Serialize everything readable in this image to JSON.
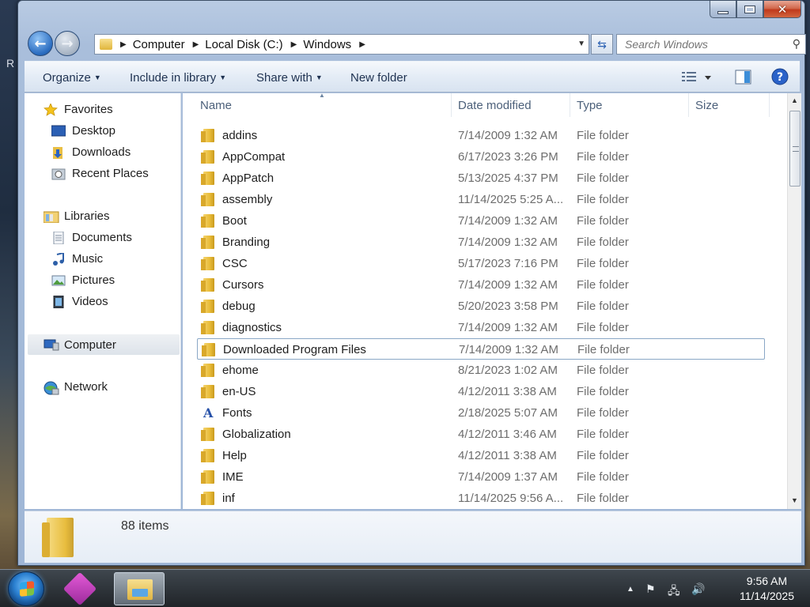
{
  "desktop": {
    "ghost_text": "R"
  },
  "window": {
    "caption": {
      "minimize": "—",
      "maximize": "▢",
      "close": "✕"
    }
  },
  "nav": {
    "back_glyph": "←",
    "forward_glyph": "→",
    "breadcrumbs": [
      "Computer",
      "Local Disk (C:)",
      "Windows"
    ],
    "crumb_separator": "▶",
    "search_placeholder": "Search Windows"
  },
  "toolbar": {
    "organize": "Organize",
    "include_in_library": "Include in library",
    "share_with": "Share with",
    "new_folder": "New folder"
  },
  "sidebar": {
    "favorites": {
      "label": "Favorites",
      "items": [
        "Desktop",
        "Downloads",
        "Recent Places"
      ]
    },
    "libraries": {
      "label": "Libraries",
      "items": [
        "Documents",
        "Music",
        "Pictures",
        "Videos"
      ]
    },
    "computer": "Computer",
    "network": "Network"
  },
  "columns": {
    "name": "Name",
    "date": "Date modified",
    "type": "Type",
    "size": "Size"
  },
  "files": [
    {
      "name": "addins",
      "date": "7/14/2009 1:32 AM",
      "type": "File folder",
      "icon": "folder-icon"
    },
    {
      "name": "AppCompat",
      "date": "6/17/2023 3:26 PM",
      "type": "File folder",
      "icon": "folder-icon"
    },
    {
      "name": "AppPatch",
      "date": "5/13/2025 4:37 PM",
      "type": "File folder",
      "icon": "folder-icon"
    },
    {
      "name": "assembly",
      "date": "11/14/2025 5:25 A...",
      "type": "File folder",
      "icon": "folder-icon"
    },
    {
      "name": "Boot",
      "date": "7/14/2009 1:32 AM",
      "type": "File folder",
      "icon": "folder-icon"
    },
    {
      "name": "Branding",
      "date": "7/14/2009 1:32 AM",
      "type": "File folder",
      "icon": "folder-icon"
    },
    {
      "name": "CSC",
      "date": "5/17/2023 7:16 PM",
      "type": "File folder",
      "icon": "folder-icon"
    },
    {
      "name": "Cursors",
      "date": "7/14/2009 1:32 AM",
      "type": "File folder",
      "icon": "folder-icon"
    },
    {
      "name": "debug",
      "date": "5/20/2023 3:58 PM",
      "type": "File folder",
      "icon": "folder-icon"
    },
    {
      "name": "diagnostics",
      "date": "7/14/2009 1:32 AM",
      "type": "File folder",
      "icon": "folder-icon"
    },
    {
      "name": "Downloaded Program Files",
      "date": "7/14/2009 1:32 AM",
      "type": "File folder",
      "icon": "folder-icon",
      "focused": true
    },
    {
      "name": "ehome",
      "date": "8/21/2023 1:02 AM",
      "type": "File folder",
      "icon": "folder-icon"
    },
    {
      "name": "en-US",
      "date": "4/12/2011 3:38 AM",
      "type": "File folder",
      "icon": "folder-icon"
    },
    {
      "name": "Fonts",
      "date": "2/18/2025 5:07 AM",
      "type": "File folder",
      "icon": "fonts-folder-icon"
    },
    {
      "name": "Globalization",
      "date": "4/12/2011 3:46 AM",
      "type": "File folder",
      "icon": "folder-icon"
    },
    {
      "name": "Help",
      "date": "4/12/2011 3:38 AM",
      "type": "File folder",
      "icon": "folder-icon"
    },
    {
      "name": "IME",
      "date": "7/14/2009 1:37 AM",
      "type": "File folder",
      "icon": "folder-icon"
    },
    {
      "name": "inf",
      "date": "11/14/2025 9:56 A...",
      "type": "File folder",
      "icon": "folder-icon"
    }
  ],
  "details": {
    "item_count": "88 items"
  },
  "taskbar": {
    "clock_time": "9:56 AM",
    "clock_date": "11/14/2025",
    "tray": {
      "show_hidden": "▲",
      "action_center": "⚑",
      "network": "🖧",
      "volume": "🔊"
    }
  }
}
